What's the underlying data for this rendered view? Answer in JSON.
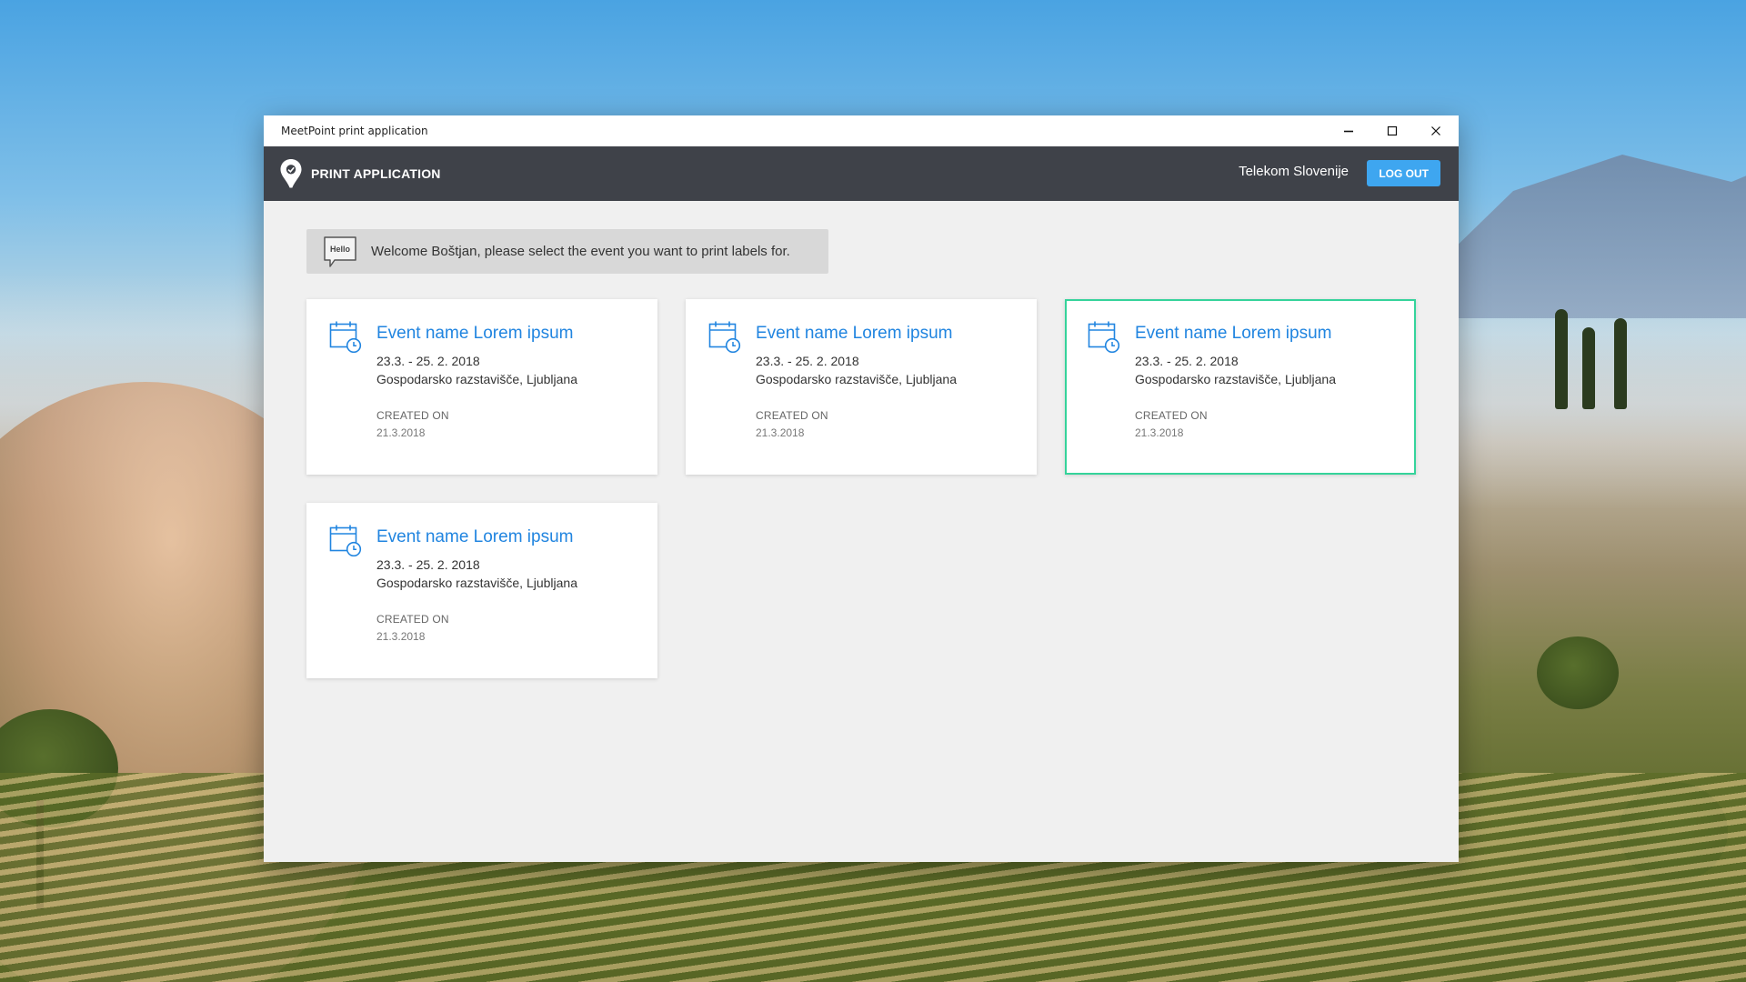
{
  "window": {
    "title": "MeetPoint print application"
  },
  "header": {
    "title": "PRINT APPLICATION",
    "organization": "Telekom Slovenije",
    "logout_label": "LOG OUT"
  },
  "welcome": {
    "badge": "Hello",
    "message": "Welcome Boštjan, please select the event you want to print labels for."
  },
  "events": [
    {
      "title": "Event name Lorem ipsum",
      "dates": "23.3. - 25. 2. 2018",
      "venue": "Gospodarsko razstavišče, Ljubljana",
      "created_label": "CREATED ON",
      "created_date": "21.3.2018",
      "selected": false
    },
    {
      "title": "Event name Lorem ipsum",
      "dates": "23.3. - 25. 2. 2018",
      "venue": "Gospodarsko razstavišče, Ljubljana",
      "created_label": "CREATED ON",
      "created_date": "21.3.2018",
      "selected": false
    },
    {
      "title": "Event name Lorem ipsum",
      "dates": "23.3. - 25. 2. 2018",
      "venue": "Gospodarsko razstavišče, Ljubljana",
      "created_label": "CREATED ON",
      "created_date": "21.3.2018",
      "selected": true
    },
    {
      "title": "Event name Lorem ipsum",
      "dates": "23.3. - 25. 2. 2018",
      "venue": "Gospodarsko razstavišče, Ljubljana",
      "created_label": "CREATED ON",
      "created_date": "21.3.2018",
      "selected": false
    }
  ],
  "icons": {
    "logo": "location-pin-icon",
    "welcome": "hello-speech-bubble-icon",
    "event": "calendar-clock-icon",
    "minimize": "minimize-icon",
    "maximize": "maximize-icon",
    "close": "close-icon"
  },
  "colors": {
    "header_bg": "#3f4249",
    "accent_blue": "#3ea6f0",
    "event_title": "#2185e0",
    "selected_border": "#35d39b",
    "content_bg": "#f0f0f0"
  }
}
